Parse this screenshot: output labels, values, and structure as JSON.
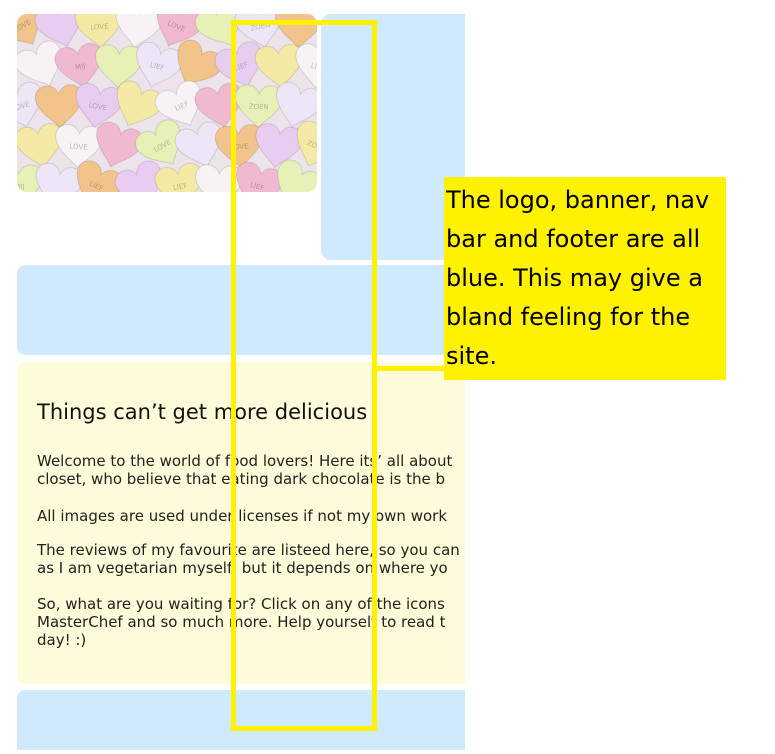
{
  "colors": {
    "section_blue": "#cfeafb",
    "content_yellow": "#fdfbd9",
    "annotation_yellow": "#fff200"
  },
  "hero_image": {
    "icon": "candy-hearts-image",
    "heart_words": [
      "LOVE",
      "LOVE",
      "LOVE",
      "ZOEN",
      "MIJ",
      "LIEF",
      "LIEF",
      "LIEF",
      "LOVE",
      "LOVE",
      "LIEF",
      "ZOEN"
    ]
  },
  "content": {
    "heading": "Things can’t get more delicious",
    "paragraphs": [
      "Welcome to the world of food lovers! Here its’ all about\ncloset, who believe that eating dark chocolate is the b",
      "All images are used under licenses if not my own work",
      "The reviews of my favourite are listeed here, so you can\nas I am vegetarian myself, but it depends on where yo",
      "So, what are you waiting for? Click on any of the icons\nMasterChef and so much more. Help yourself to read t\nday! :)"
    ]
  },
  "annotation": {
    "note": "The logo, banner, nav bar and footer are all blue. This may give a bland feeling for the site."
  }
}
